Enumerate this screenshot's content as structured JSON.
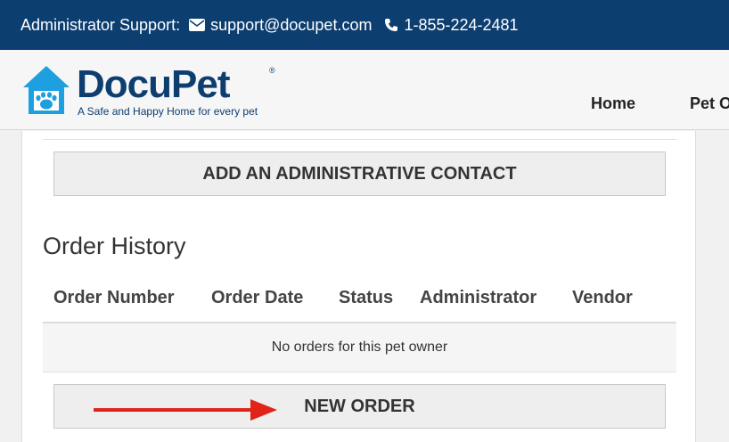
{
  "topbar": {
    "label": "Administrator Support:",
    "email": "support@docupet.com",
    "phone": "1-855-224-2481",
    "email_icon": "envelope-icon",
    "phone_icon": "phone-icon"
  },
  "header": {
    "brand_docu": "Docu",
    "brand_pet": "Pet",
    "trademark": "®",
    "tagline": "A Safe and Happy Home for every pet",
    "nav": [
      "Home",
      "Pet O"
    ]
  },
  "panel": {
    "add_contact_label": "ADD AN ADMINISTRATIVE CONTACT",
    "section_title": "Order History",
    "columns": [
      "Order Number",
      "Order Date",
      "Status",
      "Administrator",
      "Vendor"
    ],
    "empty_message": "No orders for this pet owner",
    "new_order_label": "NEW ORDER"
  },
  "colors": {
    "topbar_bg": "#0d3e70",
    "logo_blue": "#1e9fe0",
    "arrow_red": "#e02418"
  }
}
